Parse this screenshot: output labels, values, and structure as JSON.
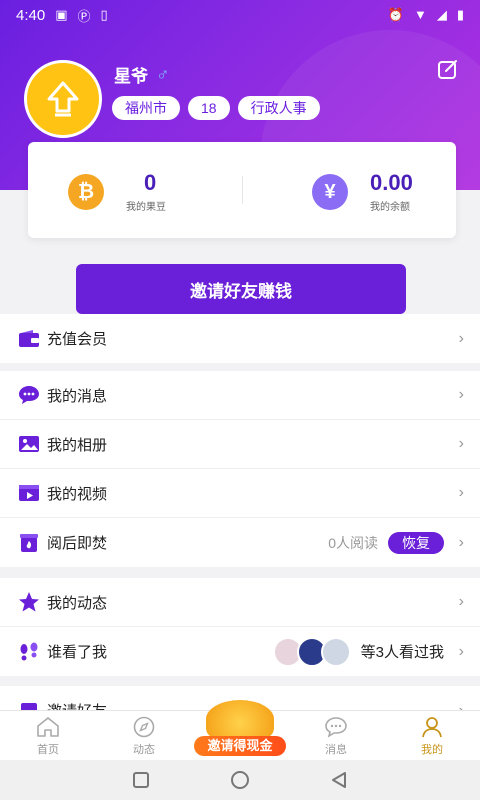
{
  "status_bar": {
    "time": "4:40"
  },
  "profile": {
    "name": "星爷",
    "gender_symbol": "♂",
    "tags": [
      "福州市",
      "18",
      "行政人事"
    ]
  },
  "wallet": {
    "beans_value": "0",
    "beans_label": "我的果豆",
    "balance_value": "0.00",
    "balance_label": "我的余额",
    "btc_symbol": "₿",
    "yen_symbol": "¥"
  },
  "invite_button": "邀请好友赚钱",
  "menu": {
    "recharge": "充值会员",
    "messages": "我的消息",
    "album": "我的相册",
    "videos": "我的视频",
    "burn_after_reading": "阅后即焚",
    "read_count": "0人阅读",
    "restore": "恢复",
    "moments": "我的动态",
    "who_viewed": "谁看了我",
    "viewers_text": "等3人看过我",
    "invite_friends": "邀请好友"
  },
  "tabbar": {
    "home": "首页",
    "dynamics": "动态",
    "promo": "邀请得现金",
    "messages": "消息",
    "mine": "我的"
  },
  "colors": {
    "primary": "#6a1fd8",
    "accent_gold": "#c8951a",
    "avatar": "#ffc313"
  }
}
